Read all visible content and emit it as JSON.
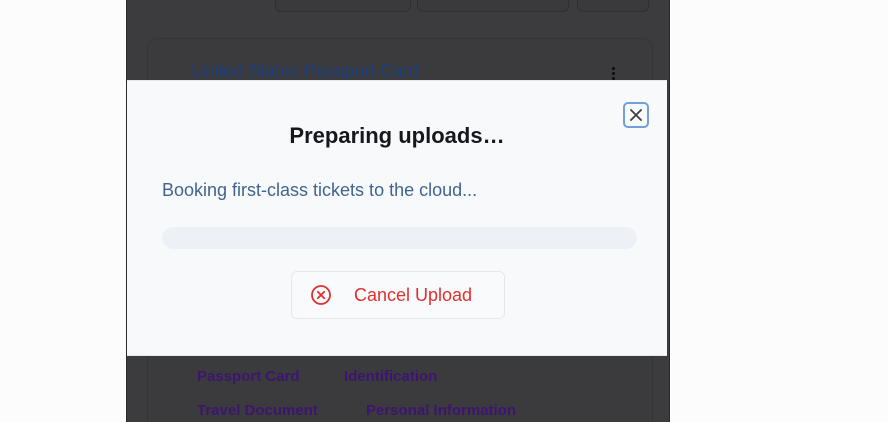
{
  "background": {
    "card_title": "United States Passport Card",
    "tags": [
      "Passport Card",
      "Identification",
      "Travel Document",
      "Personal Information"
    ]
  },
  "modal": {
    "title": "Preparing uploads…",
    "status_text": "Booking first-class tickets to the cloud...",
    "progress": 0,
    "close_icon": "close-icon",
    "cancel_label": "Cancel Upload",
    "cancel_icon": "x-circle-icon"
  },
  "colors": {
    "accent": "#6fa0d9",
    "danger": "#df2f2f",
    "status_text": "#41648f"
  }
}
